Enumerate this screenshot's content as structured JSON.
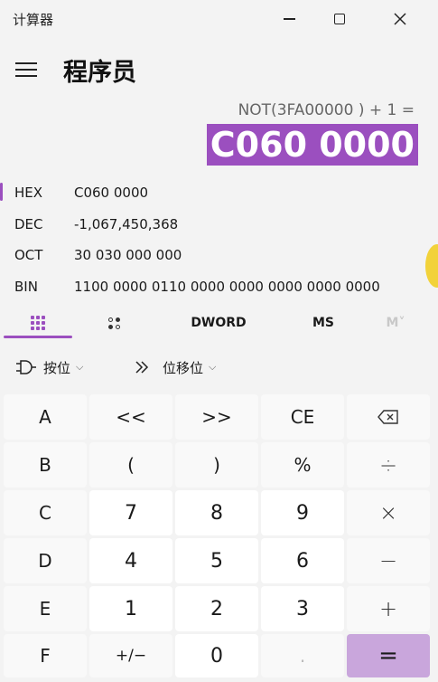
{
  "window": {
    "title": "计算器",
    "controls": [
      "minimize-icon",
      "maximize-icon",
      "close-icon"
    ]
  },
  "header": {
    "menu_icon": "hamburger-menu-icon",
    "mode": "程序员"
  },
  "display": {
    "expression": "NOT(3FA00000 ) + 1 =",
    "result": "C060 0000"
  },
  "radix": [
    {
      "name": "HEX",
      "value": "C060 0000",
      "active": true
    },
    {
      "name": "DEC",
      "value": "-1,067,450,368",
      "active": false
    },
    {
      "name": "OCT",
      "value": "30 030 000 000",
      "active": false
    },
    {
      "name": "BIN",
      "value": "1100 0000 0110 0000 0000 0000 0000 0000",
      "active": false
    }
  ],
  "tabs": {
    "keypad_icon": "full-keypad-icon",
    "bit_icon": "bit-toggle-keypad-icon",
    "word_size": "DWORD",
    "memory_store": "MS",
    "memory_plus": "M˅"
  },
  "operators": {
    "bitwise_label": "按位",
    "shift_label": "位移位"
  },
  "keys": {
    "a": "A",
    "lshift": "<<",
    "rshift": ">>",
    "ce": "CE",
    "backspace_icon": "backspace-icon",
    "b": "B",
    "lparen": "(",
    "rparen": ")",
    "percent": "%",
    "divide": "÷",
    "c": "C",
    "n7": "7",
    "n8": "8",
    "n9": "9",
    "multiply": "×",
    "d": "D",
    "n4": "4",
    "n5": "5",
    "n6": "6",
    "minus": "−",
    "e": "E",
    "n1": "1",
    "n2": "2",
    "n3": "3",
    "plus": "+",
    "f": "F",
    "negate": "+/−",
    "n0": "0",
    "decimal": ".",
    "equals": "="
  },
  "colors": {
    "accent": "#9b4fbf",
    "equals_bg": "#c9a6dc",
    "background": "#f3f3f3"
  }
}
